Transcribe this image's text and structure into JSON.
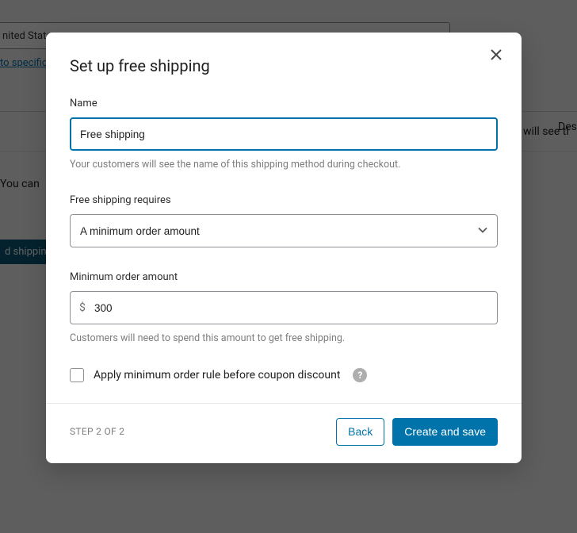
{
  "background": {
    "field_value": "nited States",
    "link_text": "to specific",
    "desc_label": "Des",
    "you_can": "You can",
    "will_see": "will see tl",
    "add_btn": "d shipping"
  },
  "modal": {
    "title": "Set up free shipping",
    "name": {
      "label": "Name",
      "value": "Free shipping",
      "helper": "Your customers will see the name of this shipping method during checkout."
    },
    "requires": {
      "label": "Free shipping requires",
      "selected": "A minimum order amount"
    },
    "min_amount": {
      "label": "Minimum order amount",
      "currency": "$",
      "value": "300",
      "helper": "Customers will need to spend this amount to get free shipping."
    },
    "checkbox": {
      "label": "Apply minimum order rule before coupon discount",
      "checked": false
    },
    "footer": {
      "step": "STEP 2 OF 2",
      "back": "Back",
      "submit": "Create and save"
    }
  }
}
